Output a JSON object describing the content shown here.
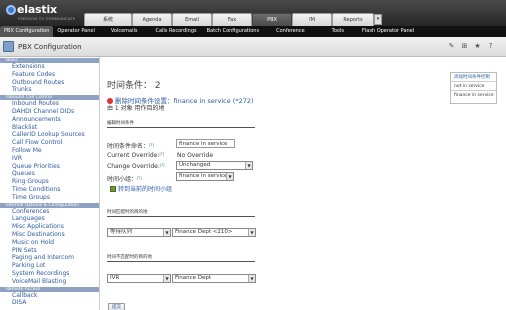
{
  "brand": {
    "name": "elastix",
    "tagline": "FREEDOM TO COMMUNICATE"
  },
  "main_tabs": [
    {
      "label": "系统",
      "active": false
    },
    {
      "label": "Agenda",
      "active": false
    },
    {
      "label": "Email",
      "active": false
    },
    {
      "label": "Fax",
      "active": false
    },
    {
      "label": "PBX",
      "active": true
    },
    {
      "label": "IM",
      "active": false
    },
    {
      "label": "Reports",
      "active": false
    }
  ],
  "more_tabs_arrow": "▾",
  "sub_tabs": [
    {
      "label": "PBX Configuration",
      "active": true
    },
    {
      "label": "Operator Panel",
      "active": false
    },
    {
      "label": "Voicemails",
      "active": false
    },
    {
      "label": "Calls Recordings",
      "active": false
    },
    {
      "label": "Batch Configurations",
      "active": false
    },
    {
      "label": "Conference",
      "active": false
    },
    {
      "label": "Tools",
      "active": false
    },
    {
      "label": "Flash Operator Panel",
      "active": false
    }
  ],
  "module": {
    "title": "PBX Configuration"
  },
  "toolbar_icons": [
    "edit-icon",
    "add-tab-icon",
    "star-icon",
    "help-icon"
  ],
  "sidebar": {
    "sections": [
      {
        "title": "Basic",
        "items": [
          "Extensions",
          "Feature Codes",
          "Outbound Routes",
          "Trunks"
        ]
      },
      {
        "title": "Inbound Call Control",
        "items": [
          "Inbound Routes",
          "DAHDI Channel DIDs",
          "Announcements",
          "Blacklist",
          "CallerID Lookup Sources",
          "Call Flow Control",
          "Follow Me",
          "IVR",
          "Queue Priorities",
          "Queues",
          "Ring Groups",
          "Time Conditions",
          "Time Groups"
        ]
      },
      {
        "title": "Internal Options & Configuration",
        "items": [
          "Conferences",
          "Languages",
          "Misc Applications",
          "Misc Destinations",
          "Music on Hold",
          "PIN Sets",
          "Paging and Intercom",
          "Parking Lot",
          "System Recordings",
          "VoiceMail Blasting"
        ]
      },
      {
        "title": "Remote Access",
        "items": [
          "Callback",
          "DISA"
        ]
      }
    ]
  },
  "page": {
    "title": "时间条件： 2",
    "delete_link": "删除时间条件设置：finance in service (*272)",
    "used_by": "由 1 对象 用作目的地",
    "edit_section": "编辑时间条件",
    "fields": {
      "name_label": "时间条件命名：",
      "name_value": "finance in service",
      "current_override_label": "Current Override:",
      "current_override_value": "No Override",
      "change_override_label": "Change Override:",
      "change_override_value": "Unchanged",
      "time_group_label": "时间小组：",
      "time_group_value": "finance in service"
    },
    "goto_timegroup": "转到当前的时间小组",
    "match_section": "时间匹配时的目的地",
    "match_dest": {
      "type": "等待队列",
      "target": "Finance Dept <210>"
    },
    "nomatch_section": "时间不匹配时的目的地",
    "nomatch_dest": {
      "type": "IVR",
      "target": "Finance Dept"
    },
    "submit_label": "提交",
    "help_marker": "[?]"
  },
  "right_panel": {
    "items": [
      "添加时间条件控制",
      "not in service",
      "finance in service"
    ]
  }
}
